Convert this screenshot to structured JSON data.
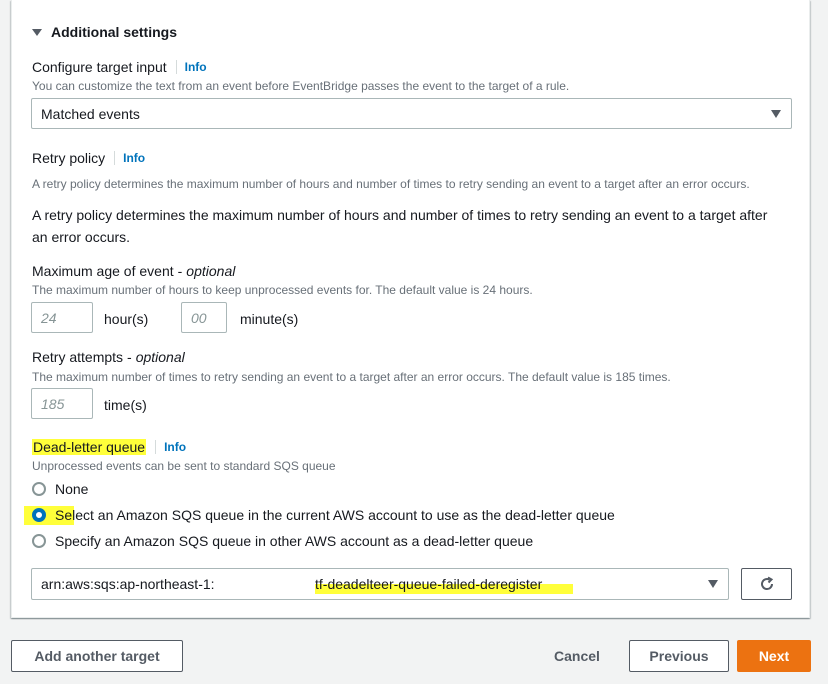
{
  "section": {
    "title": "Additional settings"
  },
  "target_input": {
    "label": "Configure target input",
    "info": "Info",
    "description": "You can customize the text from an event before EventBridge passes the event to the target of a rule.",
    "selected": "Matched events"
  },
  "retry_policy": {
    "label": "Retry policy",
    "info": "Info",
    "description": "A retry policy determines the maximum number of hours and number of times to retry sending an event to a target after an error occurs.",
    "body": "A retry policy determines the maximum number of hours and number of times to retry sending an event to a target after an error occurs."
  },
  "max_age": {
    "label": "Maximum age of event",
    "optional": "optional",
    "description": "The maximum number of hours to keep unprocessed events for. The default value is 24 hours.",
    "hours_placeholder": "24",
    "hours_unit": "hour(s)",
    "minutes_placeholder": "00",
    "minutes_unit": "minute(s)"
  },
  "retry_attempts": {
    "label": "Retry attempts",
    "optional": "optional",
    "description": "The maximum number of times to retry sending an event to a target after an error occurs. The default value is 185 times.",
    "placeholder": "185",
    "unit": "time(s)"
  },
  "dlq": {
    "label": "Dead-letter queue",
    "info": "Info",
    "description": "Unprocessed events can be sent to standard SQS queue",
    "options": [
      {
        "label": "None"
      },
      {
        "label": "Select an Amazon SQS queue in the current AWS account to use as the dead-letter queue"
      },
      {
        "label": "Specify an Amazon SQS queue in other AWS account as a dead-letter queue"
      }
    ],
    "selected_index": 1,
    "queue_prefix": "arn:aws:sqs:ap-northeast-1:",
    "queue_name": "tf-deadelteer-queue-failed-deregister"
  },
  "footer": {
    "add_target": "Add another target",
    "cancel": "Cancel",
    "previous": "Previous",
    "next": "Next"
  },
  "colors": {
    "primary": "#ec7211",
    "link": "#0073bb",
    "highlight": "#ffff3a"
  }
}
